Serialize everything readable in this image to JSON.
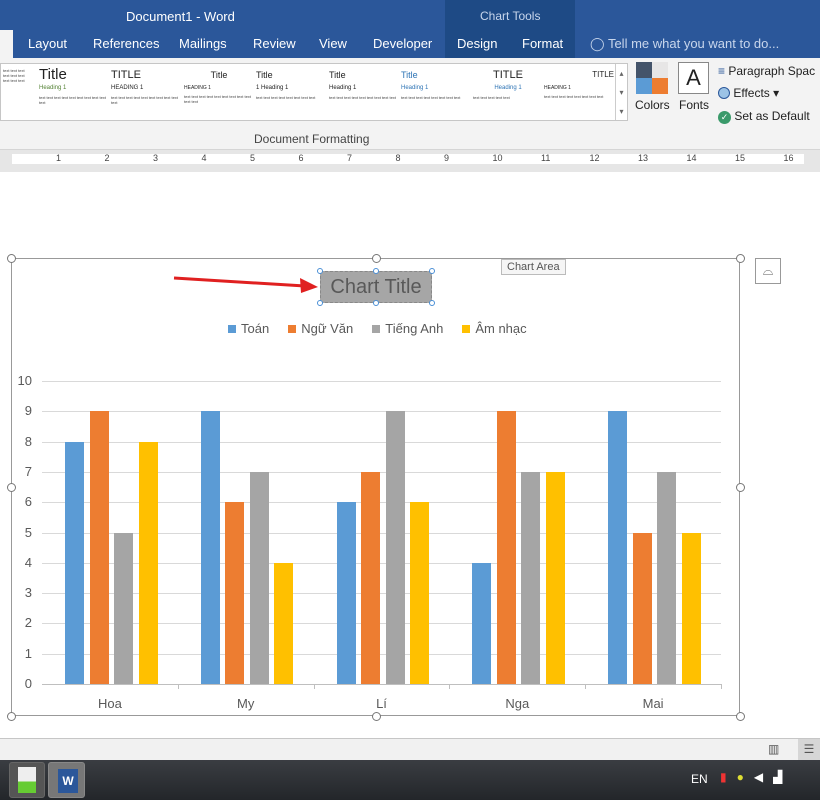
{
  "window": {
    "title": "Document1 - Word",
    "context_title": "Chart Tools"
  },
  "tabs": [
    "Layout",
    "References",
    "Mailings",
    "Review",
    "View",
    "Developer",
    "Design",
    "Format"
  ],
  "tell_me": "Tell me what you want to do...",
  "gallery": {
    "items": [
      {
        "title": "",
        "heading": ""
      },
      {
        "title": "Title",
        "heading": "Heading 1"
      },
      {
        "title": "TITLE",
        "heading": "HEADING 1"
      },
      {
        "title": "Title",
        "heading": "HEADING 1"
      },
      {
        "title": "Title",
        "heading": "1 Heading 1"
      },
      {
        "title": "Title",
        "heading": "Heading 1"
      },
      {
        "title": "Title",
        "heading": "Heading 1"
      },
      {
        "title": "TITLE",
        "heading": "Heading 1"
      },
      {
        "title": "TITLE",
        "heading": "HEADING 1"
      }
    ],
    "group_label": "Document Formatting"
  },
  "ribbon": {
    "colors": "Colors",
    "fonts": "Fonts",
    "fonts_glyph": "A",
    "paragraph_spacing": "Paragraph Spac",
    "effects": "Effects",
    "set_default": "Set as Default"
  },
  "ruler": [
    "1",
    "2",
    "3",
    "4",
    "5",
    "6",
    "7",
    "8",
    "9",
    "10",
    "11",
    "12",
    "13",
    "14",
    "15",
    "16"
  ],
  "chart": {
    "tooltip": "Chart Area"
  },
  "chart_data": {
    "type": "bar",
    "title": "Chart Title",
    "categories": [
      "Hoa",
      "My",
      "Lí",
      "Nga",
      "Mai"
    ],
    "series": [
      {
        "name": "Toán",
        "color": "#5b9bd5",
        "values": [
          8,
          9,
          6,
          4,
          9
        ]
      },
      {
        "name": "Ngữ Văn",
        "color": "#ed7d31",
        "values": [
          9,
          6,
          7,
          9,
          5
        ]
      },
      {
        "name": "Tiếng Anh",
        "color": "#a5a5a5",
        "values": [
          5,
          7,
          9,
          7,
          7
        ]
      },
      {
        "name": "Âm nhạc",
        "color": "#ffc000",
        "values": [
          8,
          4,
          6,
          7,
          5
        ]
      }
    ],
    "ylim": [
      0,
      10
    ],
    "yticks": [
      "0",
      "1",
      "2",
      "3",
      "4",
      "5",
      "6",
      "7",
      "8",
      "9",
      "10"
    ],
    "grid": true,
    "legend": "top"
  },
  "taskbar": {
    "language": "EN"
  }
}
